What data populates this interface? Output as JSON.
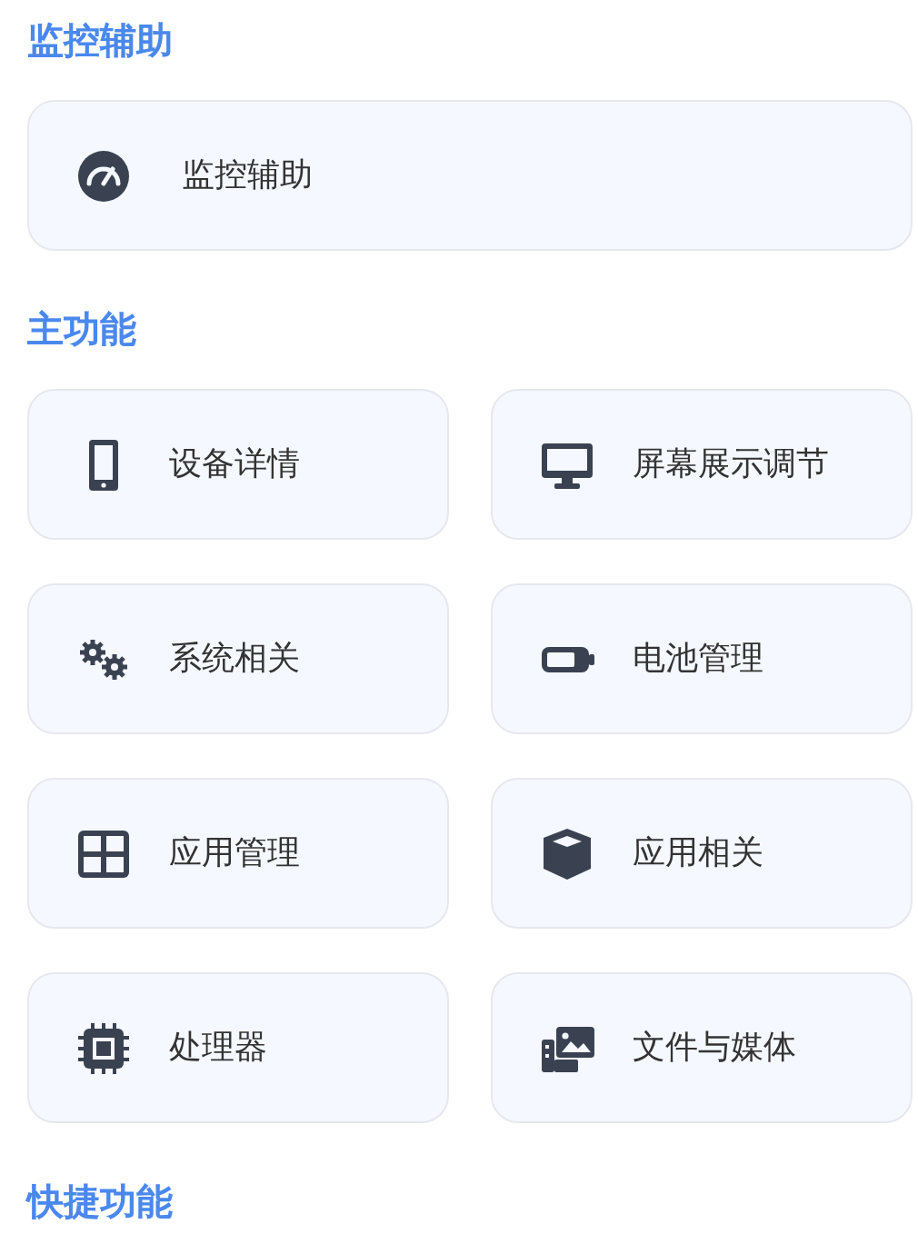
{
  "sections": [
    {
      "title": "监控辅助",
      "kind": "wide",
      "items": [
        {
          "label": "监控辅助"
        }
      ]
    },
    {
      "title": "主功能",
      "kind": "grid",
      "items": [
        {
          "label": "设备详情"
        },
        {
          "label": "屏幕展示调节"
        },
        {
          "label": "系统相关"
        },
        {
          "label": "电池管理"
        },
        {
          "label": "应用管理"
        },
        {
          "label": "应用相关"
        },
        {
          "label": "处理器"
        },
        {
          "label": "文件与媒体"
        }
      ]
    },
    {
      "title": "快捷功能"
    }
  ]
}
